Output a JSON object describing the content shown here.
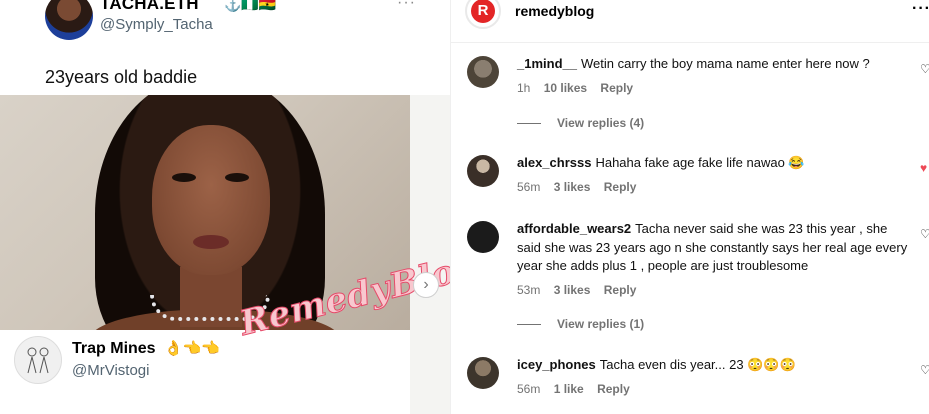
{
  "tweet": {
    "name": "TACHA.ETH",
    "flags": "⚓🇳🇬🇬🇭",
    "handle": "@Symply_Tacha",
    "more": "···",
    "caption": "23years old baddie"
  },
  "quoted_tweet": {
    "name": "Trap Mines",
    "emojis": "👌👈👈",
    "handle": "@MrVistogi"
  },
  "watermark": "RemedyBlog",
  "carousel_next": "›",
  "post": {
    "account": "remedyblog",
    "logo_letter": "R",
    "more": "···"
  },
  "comments": [
    {
      "user": "_1mind__",
      "text": "Wetin carry the boy mama name enter here now ?",
      "time": "1h",
      "likes": "10 likes",
      "reply": "Reply",
      "view_replies": "View replies (4)",
      "liked": false
    },
    {
      "user": "alex_chrsss",
      "text": "Hahaha fake age fake life nawao 😂",
      "time": "56m",
      "likes": "3 likes",
      "reply": "Reply",
      "liked": true
    },
    {
      "user": "affordable_wears2",
      "text": "Tacha never said she was 23 this year , she said she was 23 years ago n she constantly says her real age every year she adds plus 1 , people are just troublesome",
      "time": "53m",
      "likes": "3 likes",
      "reply": "Reply",
      "view_replies": "View replies (1)",
      "liked": false
    },
    {
      "user": "icey_phones",
      "text": "Tacha even dis year... 23 😳😳😳",
      "time": "56m",
      "likes": "1 like",
      "reply": "Reply",
      "liked": false
    }
  ],
  "colors": {
    "accent_red": "#e32526",
    "like_red": "#ed4956",
    "meta_gray": "#737373",
    "handle_gray": "#536471",
    "watermark_pink": "#e64b6a"
  },
  "icons": [
    "heart-icon",
    "more-icon",
    "chevron-right-icon"
  ]
}
